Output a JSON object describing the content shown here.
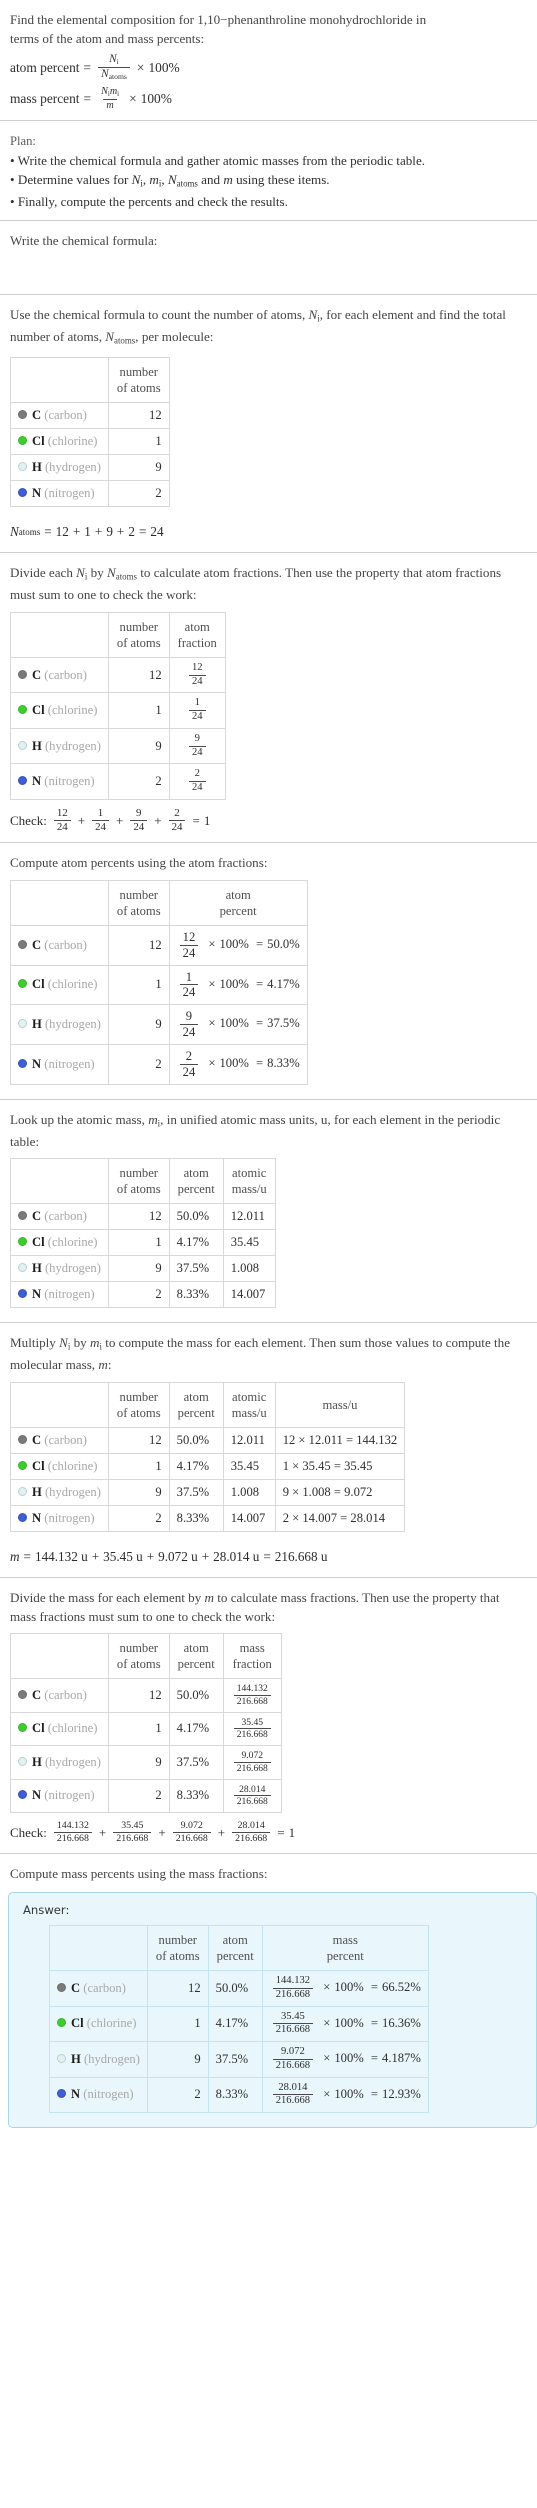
{
  "problem": {
    "prompt_line1": "Find the elemental composition for 1,10−phenanthroline monohydrochloride in",
    "prompt_line2": "terms of the atom and mass percents:",
    "atom_percent_label": "atom percent",
    "mass_percent_label": "mass percent",
    "equals": "=",
    "times": "×",
    "hundred_percent": "100%",
    "Ni": "N",
    "Ni_sub": "i",
    "Natoms": "N",
    "Natoms_sub": "atoms",
    "mi": "m",
    "mi_sub": "i",
    "m": "m"
  },
  "plan": {
    "heading": "Plan:",
    "bullets": [
      "• Write the chemical formula and gather atomic masses from the periodic table.",
      "• Determine values for Nᵢ, mᵢ, Nₐₜₒₘₛ and m using these items.",
      "• Finally, compute the percents and check the results."
    ],
    "bullet2_parts": {
      "pre": "• Determine values for ",
      "mid1": ", ",
      "mid2": ", ",
      "mid3": " and ",
      "post": " using these items."
    }
  },
  "steps": {
    "write_formula": "Write the chemical formula:",
    "count_atoms_line1": "Use the chemical formula to count the number of atoms, Nᵢ, for each element",
    "count_atoms_line2": "and find the total number of atoms, Nₐₜₒₘₛ, per molecule:",
    "count_atoms_pre": "Use the chemical formula to count the number of atoms, ",
    "count_atoms_mid": ", for each element and find the total number of atoms, ",
    "count_atoms_post": ", per molecule:",
    "atom_fraction_pre": "Divide each ",
    "atom_fraction_mid": " by ",
    "atom_fraction_post": " to calculate atom fractions. Then use the property that atom fractions must sum to one to check the work:",
    "atom_percent_intro": "Compute atom percents using the atom fractions:",
    "atomic_mass_pre": "Look up the atomic mass, ",
    "atomic_mass_post": ", in unified atomic mass units, u, for each element in the periodic table:",
    "mass_pre": "Multiply ",
    "mass_mid": " by ",
    "mass_post": " to compute the mass for each element. Then sum those values to compute the molecular mass, ",
    "mass_post_colon": ":",
    "mass_fraction_pre": "Divide the mass for each element by ",
    "mass_fraction_post": " to calculate mass fractions. Then use the property that mass fractions must sum to one to check the work:",
    "mass_percent_intro": "Compute mass percents using the mass fractions:",
    "answer_label": "Answer:"
  },
  "headers": {
    "blank": "",
    "number_of_atoms_l1": "number",
    "number_of_atoms_l2": "of atoms",
    "atom_fraction_l1": "atom",
    "atom_fraction_l2": "fraction",
    "atom_percent_l1": "atom",
    "atom_percent_l2": "percent",
    "atomic_mass_l1": "atomic",
    "atomic_mass_l2": "mass/u",
    "mass_l1": "mass/u",
    "mass_fraction_l1": "mass",
    "mass_fraction_l2": "fraction",
    "mass_percent_l1": "mass",
    "mass_percent_l2": "percent"
  },
  "elements": [
    {
      "symbol": "C",
      "name": "(carbon)",
      "color": "#7a7a7a",
      "border": "#6d6d6d",
      "number_of_atoms": "12",
      "atom_fraction_num": "12",
      "atom_fraction_den": "24",
      "atom_percent": "50.0%",
      "atomic_mass": "12.011",
      "mass_expr": "12 × 12.011 = 144.132",
      "mass_mult_n": "12",
      "mass_mult_m": "12.011",
      "mass_value": "144.132",
      "mass_fraction_num": "144.132",
      "mass_fraction_den": "216.668",
      "mass_percent": "66.52%"
    },
    {
      "symbol": "Cl",
      "name": "(chlorine)",
      "color": "#3ecc2e",
      "border": "#35b827",
      "number_of_atoms": "1",
      "atom_fraction_num": "1",
      "atom_fraction_den": "24",
      "atom_percent": "4.17%",
      "atomic_mass": "35.45",
      "mass_expr": "1 × 35.45 = 35.45",
      "mass_mult_n": "1",
      "mass_mult_m": "35.45",
      "mass_value": "35.45",
      "mass_fraction_num": "35.45",
      "mass_fraction_den": "216.668",
      "mass_percent": "16.36%"
    },
    {
      "symbol": "H",
      "name": "(hydrogen)",
      "color": "#e2f2f2",
      "border": "#b9cfcf",
      "number_of_atoms": "9",
      "atom_fraction_num": "9",
      "atom_fraction_den": "24",
      "atom_percent": "37.5%",
      "atomic_mass": "1.008",
      "mass_expr": "9 × 1.008 = 9.072",
      "mass_mult_n": "9",
      "mass_mult_m": "1.008",
      "mass_value": "9.072",
      "mass_fraction_num": "9.072",
      "mass_fraction_den": "216.668",
      "mass_percent": "4.187%"
    },
    {
      "symbol": "N",
      "name": "(nitrogen)",
      "color": "#3f5fd0",
      "border": "#3351be",
      "number_of_atoms": "2",
      "atom_fraction_num": "2",
      "atom_fraction_den": "24",
      "atom_percent": "8.33%",
      "atomic_mass": "14.007",
      "mass_expr": "2 × 14.007 = 28.014",
      "mass_mult_n": "2",
      "mass_mult_m": "14.007",
      "mass_value": "28.014",
      "mass_fraction_num": "28.014",
      "mass_fraction_den": "216.668",
      "mass_percent": "12.93%"
    }
  ],
  "totals": {
    "natoms_equation": "Nₐₜₒₘₛ = 12 + 1 + 9 + 2 = 24",
    "natoms_terms": [
      "12",
      "1",
      "9",
      "2"
    ],
    "natoms_total": "24",
    "mass_equation": "m = 144.132 u + 35.45 u + 9.072 u + 28.014 u = 216.668 u",
    "mass_terms": [
      "144.132 u",
      "35.45 u",
      "9.072 u",
      "28.014 u"
    ],
    "mass_total": "216.668 u",
    "check_label": "Check:",
    "check_atom_result": "1",
    "check_mass_result": "1",
    "denominator_atoms": "24",
    "denominator_mass": "216.668"
  },
  "colors": {
    "answer_background": "#e9f7fc",
    "answer_border": "#a8d5e6",
    "rule": "#cfcfcf",
    "table_border": "#d8d8d8",
    "text": "#3c3c3c",
    "muted": "#a8a8a8"
  }
}
